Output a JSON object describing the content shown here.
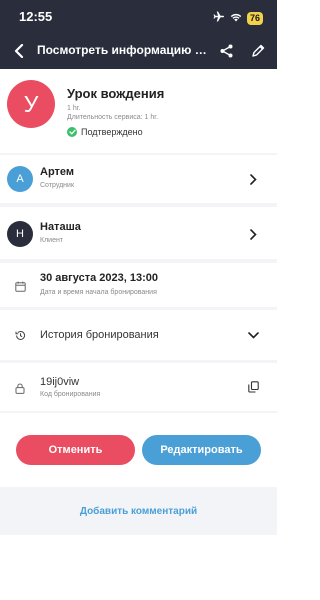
{
  "status_bar": {
    "time": "12:55",
    "battery": "76"
  },
  "nav": {
    "title": "Посмотреть информацию о ..."
  },
  "service": {
    "avatar_letter": "У",
    "name": "Урок вождения",
    "duration": "1 hr.",
    "duration_label": "Длительность сервиса: 1 hr.",
    "status": "Подтверждено"
  },
  "employee": {
    "avatar_letter": "А",
    "name": "Артем",
    "role": "Сотрудник"
  },
  "client": {
    "avatar_letter": "Н",
    "name": "Наташа",
    "role": "Клиент"
  },
  "booking_start": {
    "value": "30 августа 2023, 13:00",
    "label": "Дата и время начала бронирования"
  },
  "history": {
    "label": "История бронирования"
  },
  "booking_code": {
    "value": "19ij0viw",
    "label": "Код бронирования"
  },
  "actions": {
    "cancel": "Отменить",
    "edit": "Редактировать"
  },
  "comment": {
    "add": "Добавить комментарий"
  },
  "colors": {
    "header": "#2a2d3c",
    "accent_red": "#ea4d61",
    "accent_blue": "#4a9fd6",
    "confirmed": "#3cbf6b"
  }
}
